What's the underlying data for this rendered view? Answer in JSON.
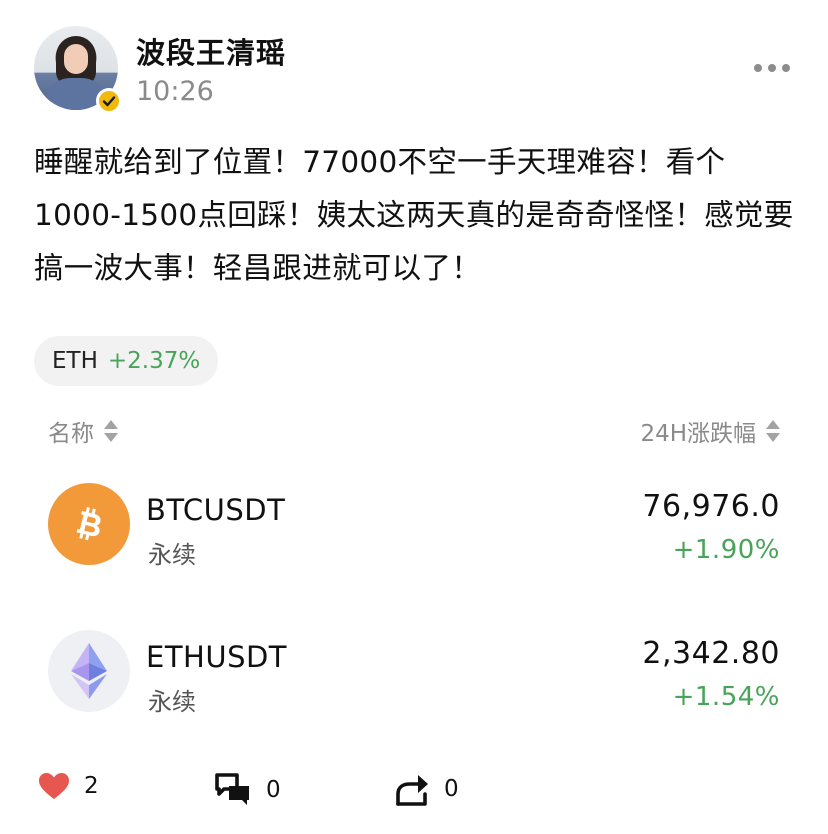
{
  "post": {
    "author_name": "波段王清瑶",
    "time": "10:26",
    "text": "睡醒就给到了位置！77000不空一手天理难容！看个1000-1500点回踩！姨太这两天真的是奇奇怪怪！感觉要搞一波大事！轻昌跟进就可以了！"
  },
  "tag_chip": {
    "symbol": "ETH",
    "change": "+2.37%"
  },
  "list_header": {
    "name_label": "名称",
    "change_label": "24H涨跌幅"
  },
  "markets": [
    {
      "icon": "bitcoin-icon",
      "pair": "BTCUSDT",
      "contract_type": "永续",
      "price": "76,976.0",
      "change": "+1.90%"
    },
    {
      "icon": "ethereum-icon",
      "pair": "ETHUSDT",
      "contract_type": "永续",
      "price": "2,342.80",
      "change": "+1.54%"
    }
  ],
  "actions": {
    "likes": "2",
    "comments": "0",
    "shares": "0"
  },
  "colors": {
    "positive": "#4aa35a",
    "bitcoin": "#f29a3a",
    "like": "#e5574f",
    "verified": "#f0b90b"
  }
}
